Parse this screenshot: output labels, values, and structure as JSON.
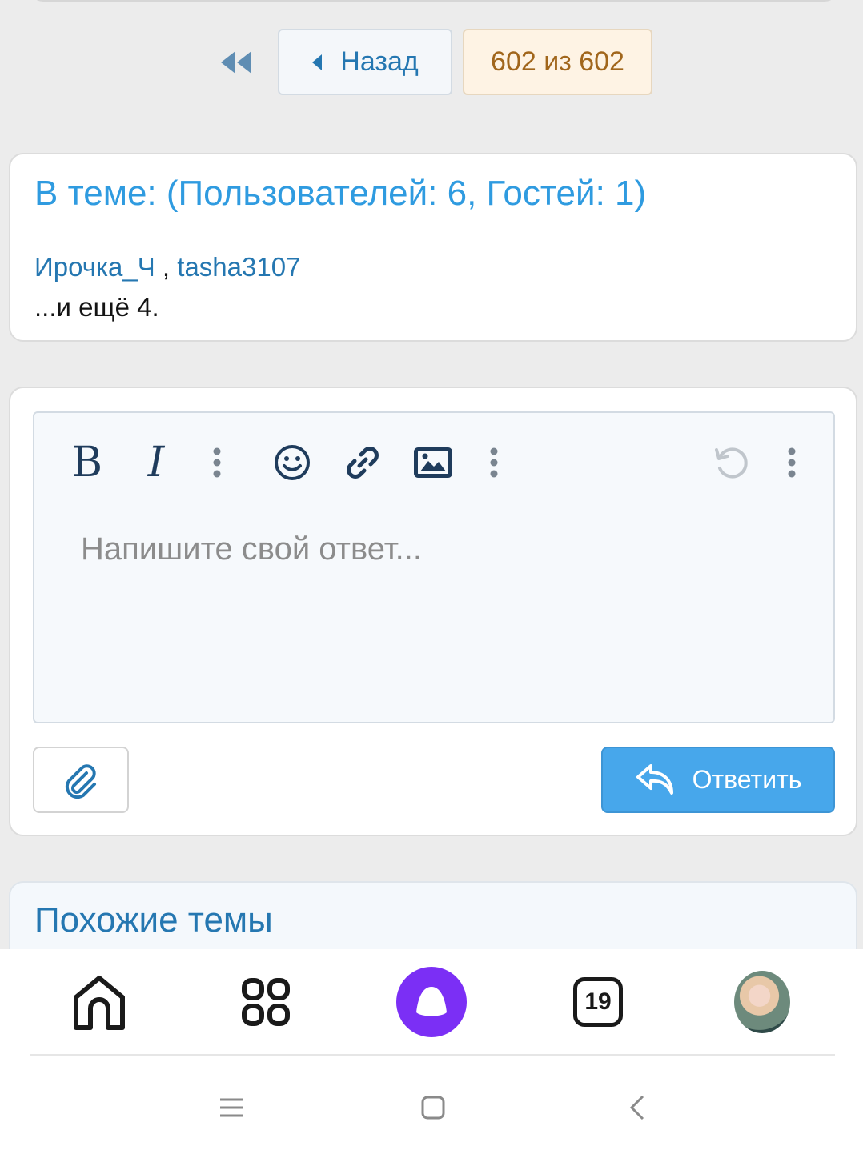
{
  "pagination": {
    "first_icon": "double-chevron-left-icon",
    "back_label": "Назад",
    "page_indicator": "602 из 602"
  },
  "online": {
    "title": "В теме: (Пользователей: 6, Гостей: 1)",
    "users": [
      "Ирочка_Ч",
      "tasha3107"
    ],
    "separator": " , ",
    "more": "...и ещё 4."
  },
  "reply": {
    "toolbar": {
      "bold": "B",
      "italic": "I",
      "icons": [
        "more-vertical-icon",
        "smiley-icon",
        "link-icon",
        "image-icon",
        "more-vertical-icon",
        "undo-icon",
        "more-vertical-icon"
      ]
    },
    "placeholder": "Напишите свой ответ...",
    "submit_label": "Ответить",
    "attach_icon": "paperclip-icon"
  },
  "similar": {
    "title": "Похожие темы"
  },
  "bottom_nav": {
    "items": [
      "home-icon",
      "apps-grid-icon",
      "alice-assistant-icon",
      "tabs-counter-icon",
      "avatar"
    ],
    "tabs_count": "19"
  },
  "system_nav": [
    "menu-icon",
    "home-square-icon",
    "back-chevron-icon"
  ],
  "colors": {
    "accent_blue": "#47a7eb",
    "link_blue": "#2577b1",
    "title_blue": "#2f9be0",
    "page_indicator_text": "#a1661c",
    "alice_purple": "#7b2ff5"
  }
}
